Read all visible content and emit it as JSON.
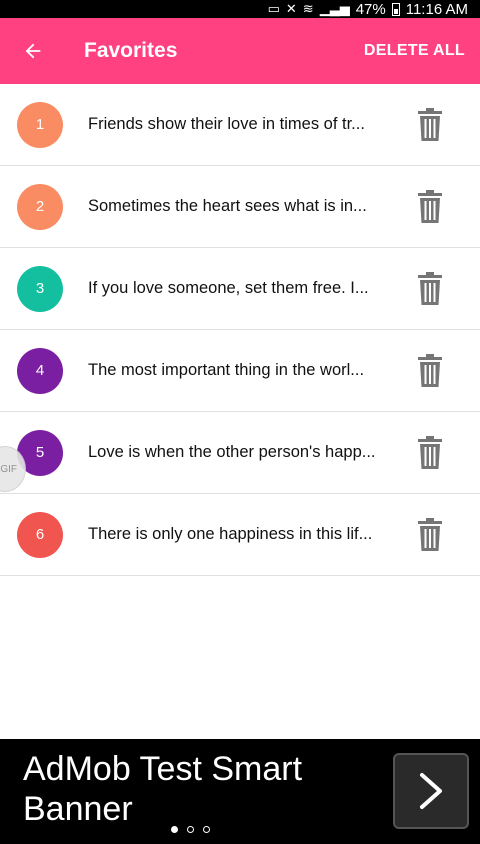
{
  "status_bar": {
    "battery": "47%",
    "time": "11:16 AM"
  },
  "app_bar": {
    "title": "Favorites",
    "delete_all_label": "DELETE ALL"
  },
  "favorites": [
    {
      "number": "1",
      "text": "Friends show their love in times of tr...",
      "color": "#fa8c64"
    },
    {
      "number": "2",
      "text": "Sometimes the heart sees what is in...",
      "color": "#fa8c64"
    },
    {
      "number": "3",
      "text": "If you love someone, set them free. I...",
      "color": "#13bf9f"
    },
    {
      "number": "4",
      "text": "The most important thing in the worl...",
      "color": "#7b1fa2"
    },
    {
      "number": "5",
      "text": "Love is when the other person's happ...",
      "color": "#7b1fa2"
    },
    {
      "number": "6",
      "text": "There is only one happiness in this lif...",
      "color": "#f0554f"
    }
  ],
  "gif_bubble_label": "GIF",
  "ad_banner": {
    "text": "AdMob Test Smart Banner",
    "page_count": 3,
    "active_page": 1
  },
  "colors": {
    "accent": "#ff4081",
    "delete_icon": "#757575"
  }
}
